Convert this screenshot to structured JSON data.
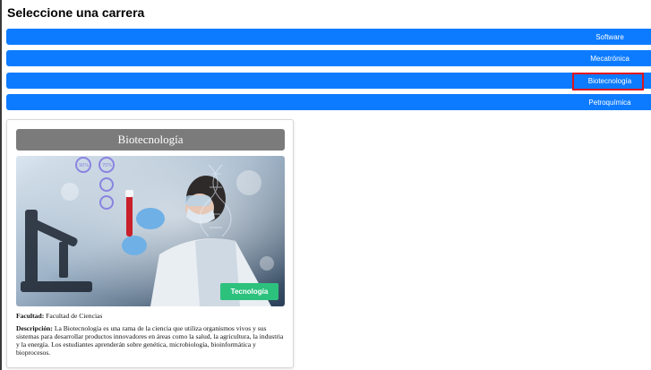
{
  "page": {
    "heading": "Seleccione una carrera"
  },
  "careers": [
    {
      "label": "Software"
    },
    {
      "label": "Mecatrónica"
    },
    {
      "label": "Biotecnología"
    },
    {
      "label": "Petroquímica"
    }
  ],
  "selected_career": "Biotecnología",
  "card": {
    "title": "Biotecnología",
    "image_alt": "Científica con guantes sosteniendo un tubo de ensayo en un laboratorio",
    "badge": "Tecnología",
    "faculty_label": "Facultad:",
    "faculty_value": "Facultad de Ciencias",
    "description_label": "Descripción:",
    "description_value": "La Biotecnología es una rama de la ciencia que utiliza organismos vivos y sus sistemas para desarrollar productos innovadores en áreas como la salud, la agricultura, la industria y la energía. Los estudiantes aprenderán sobre genética, microbiología, bioinformática y bioprocesos."
  },
  "colors": {
    "button_blue": "#0d7bff",
    "highlight_red": "#e0141e",
    "title_gray": "#7b7b7b",
    "badge_green": "#2dc17e"
  }
}
